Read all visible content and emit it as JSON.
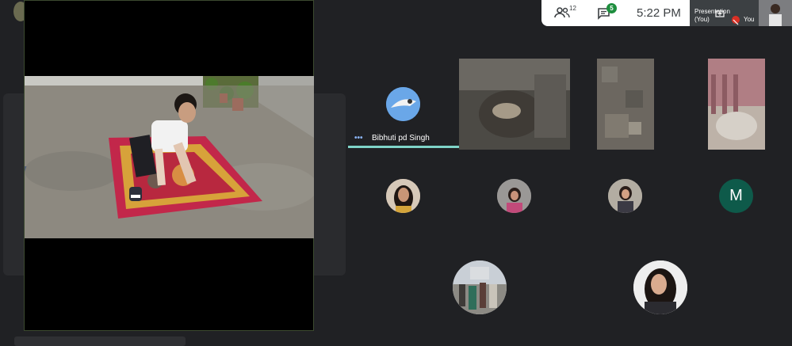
{
  "topbar": {
    "people_count": "12",
    "chat_count": "5",
    "time": "5:22 PM",
    "presentation_label": "Presentation",
    "presentation_sub": "(You)",
    "you_label": "You"
  },
  "participants": {
    "speaker_name": "Bibhuti pd Singh",
    "avatar_letter": "M"
  },
  "colors": {
    "background": "#202124",
    "accent_speaking": "#8ab4f8",
    "badge": "#1e8e3e",
    "avatar_m": "#0e5a4a"
  }
}
